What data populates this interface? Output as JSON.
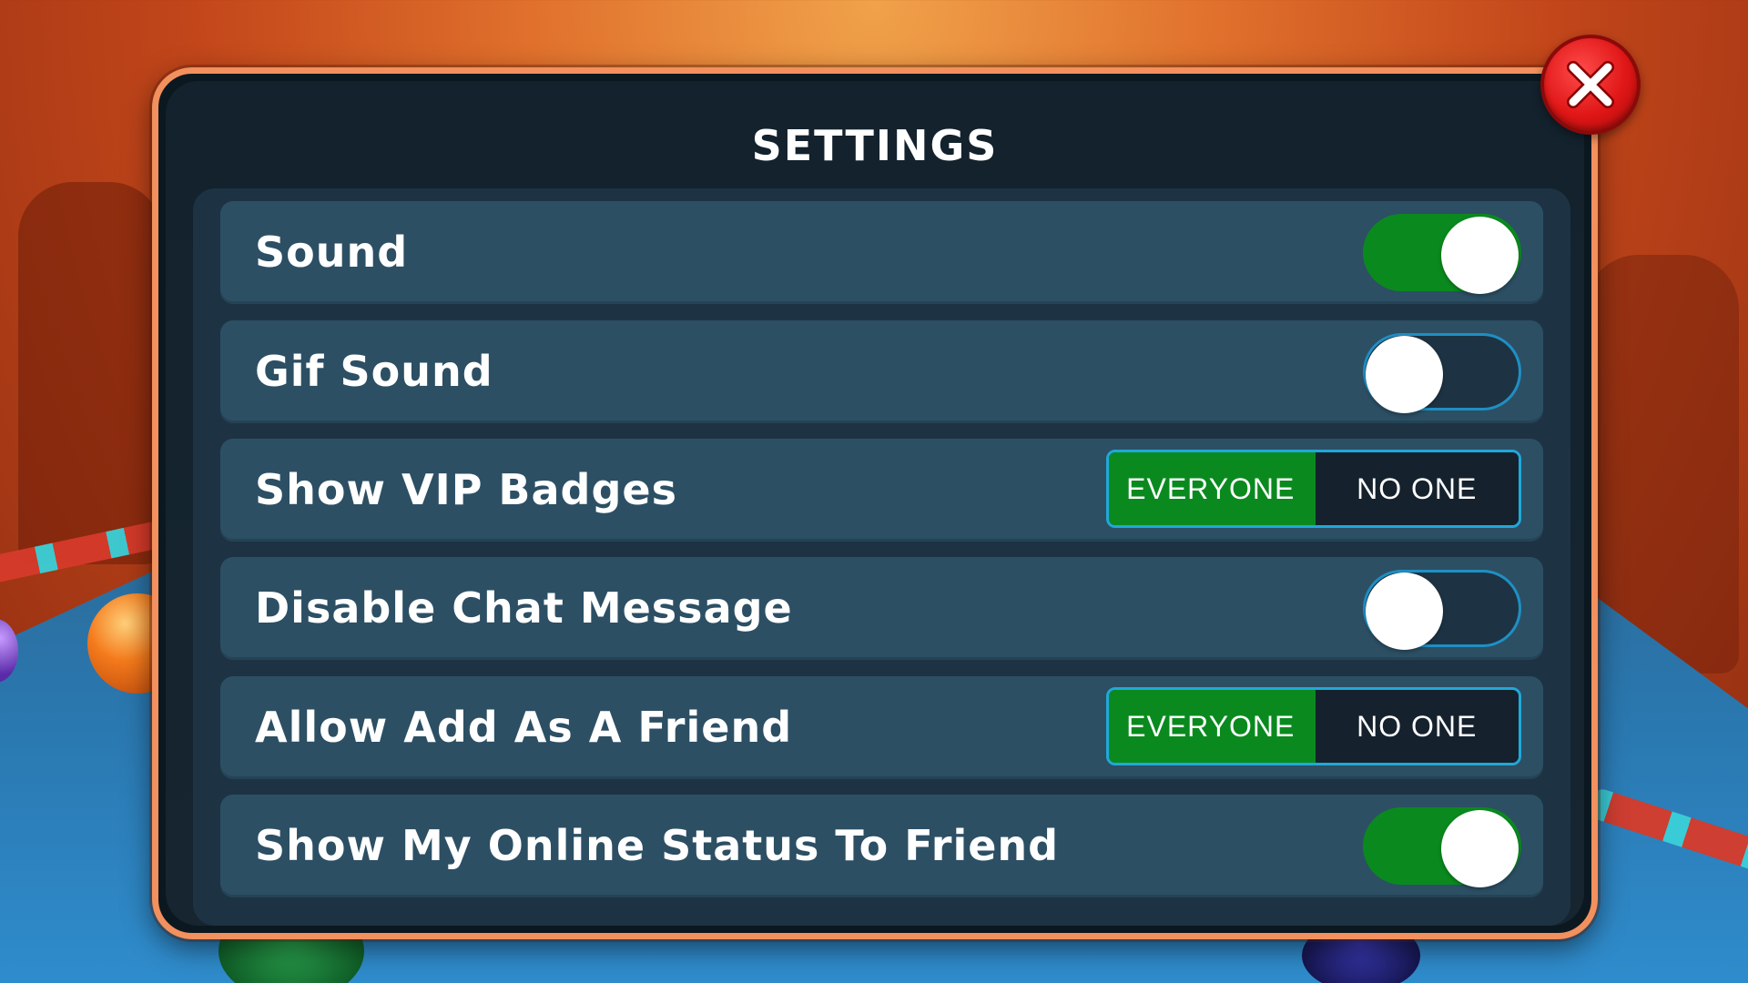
{
  "dialog": {
    "title": "SETTINGS"
  },
  "close_button": {
    "icon": "close-icon"
  },
  "settings": [
    {
      "label": "Sound",
      "control": "toggle",
      "state": "on"
    },
    {
      "label": "Gif Sound",
      "control": "toggle",
      "state": "off"
    },
    {
      "label": "Show VIP Badges",
      "control": "segmented",
      "options": [
        "EVERYONE",
        "NO ONE"
      ],
      "selected": "EVERYONE"
    },
    {
      "label": "Disable Chat Message",
      "control": "toggle",
      "state": "off"
    },
    {
      "label": "Allow Add As A Friend",
      "control": "segmented",
      "options": [
        "EVERYONE",
        "NO ONE"
      ],
      "selected": "EVERYONE"
    },
    {
      "label": "Show My Online Status To Friend",
      "control": "toggle",
      "state": "on"
    }
  ],
  "colors": {
    "toggle_on": "#0a8a1e",
    "toggle_off_border": "#1f8fc4",
    "row_background": "#2c4f64",
    "dialog_border": "#f2905e",
    "close_button": "#e01616"
  }
}
